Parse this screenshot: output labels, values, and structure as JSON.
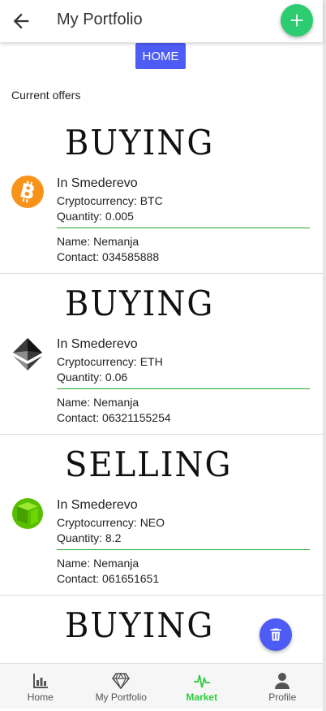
{
  "header": {
    "title": "My Portfolio"
  },
  "home_button_label": "HOME",
  "section_label": "Current offers",
  "offers": [
    {
      "type": "BUYING",
      "coin_icon": "bitcoin-icon",
      "location": "In Smederevo",
      "crypto": "Cryptocurrency: BTC",
      "quantity": "Quantity: 0.005",
      "name": "Name: Nemanja",
      "contact": "Contact: 034585888"
    },
    {
      "type": "BUYING",
      "coin_icon": "ethereum-icon",
      "location": "In Smederevo",
      "crypto": "Cryptocurrency: ETH",
      "quantity": "Quantity: 0.06",
      "name": "Name: Nemanja",
      "contact": "Contact: 06321155254"
    },
    {
      "type": "SELLING",
      "coin_icon": "neo-icon",
      "location": "In Smederevo",
      "crypto": "Cryptocurrency: NEO",
      "quantity": "Quantity: 8.2",
      "name": "Name: Nemanja",
      "contact": "Contact: 061651651"
    },
    {
      "type": "BUYING"
    }
  ],
  "bottom_nav": [
    {
      "label": "Home",
      "icon": "bar-chart-icon"
    },
    {
      "label": "My Portfolio",
      "icon": "diamond-icon"
    },
    {
      "label": "Market",
      "icon": "pulse-icon",
      "active": true
    },
    {
      "label": "Profile",
      "icon": "person-icon"
    }
  ],
  "colors": {
    "accent_green": "#2ecc71",
    "primary_blue": "#4d5cf5",
    "divider_green": "#1fa82e",
    "nav_active": "#2ecc40"
  }
}
